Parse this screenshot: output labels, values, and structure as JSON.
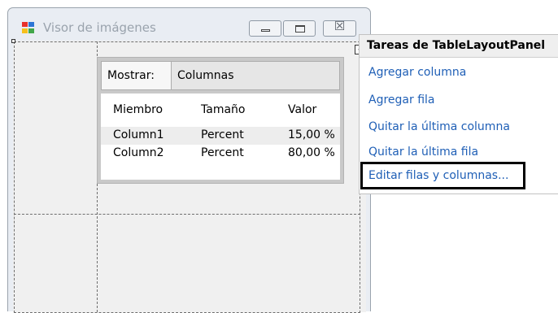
{
  "window": {
    "title": "Visor de imágenes",
    "close_glyph": "☒",
    "smart_tag_glyph": "◂"
  },
  "styles_dialog": {
    "show_label": "Mostrar:",
    "show_value": "Columnas",
    "columns": [
      "Miembro",
      "Tamaño",
      "Valor"
    ],
    "rows": [
      [
        "Column1",
        "Percent",
        "15,00 %"
      ],
      [
        "Column2",
        "Percent",
        "80,00 %"
      ]
    ]
  },
  "tasks_panel": {
    "title": "Tareas de TableLayoutPanel",
    "items": [
      "Agregar columna",
      "Agregar fila",
      "Quitar la última columna",
      "Quitar la última fila",
      "Editar filas y columnas..."
    ]
  },
  "colors": {
    "link": "#1f5fb6",
    "focus_border": "#000000",
    "icon_red": "#e8312b",
    "icon_blue": "#2c75d6",
    "icon_yellow": "#f6c01c",
    "icon_green": "#41a74a"
  }
}
